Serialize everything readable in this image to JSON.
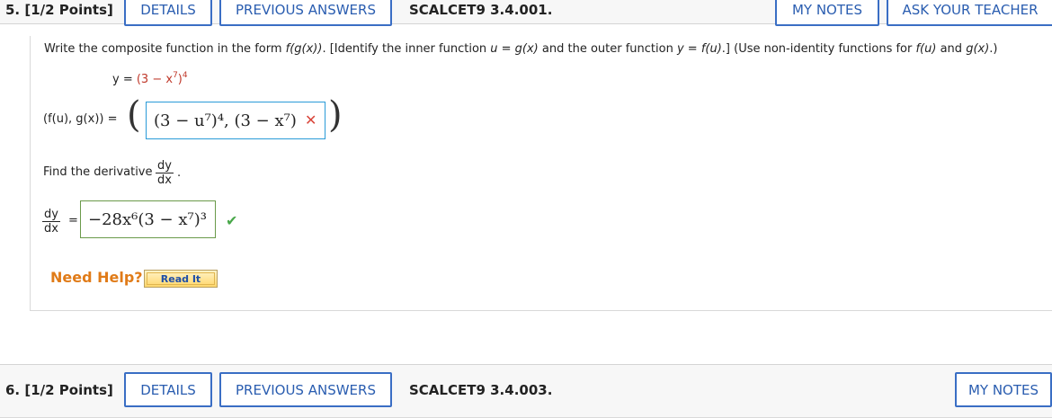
{
  "question5": {
    "number": "5.",
    "points": "[1/2 Points]",
    "details_label": "DETAILS",
    "previous_answers_label": "PREVIOUS ANSWERS",
    "code": "SCALCET9 3.4.001.",
    "my_notes_label": "MY NOTES",
    "ask_teacher_label": "ASK YOUR TEACHER",
    "prompt_start": "Write the composite function in the form ",
    "prompt_form": "f(g(x))",
    "prompt_mid": ". [Identify the inner function ",
    "prompt_inner": "u = g(x)",
    "prompt_mid2": " and the outer function ",
    "prompt_outer": "y = f(u)",
    "prompt_end": ".] (Use non-identity functions for ",
    "prompt_fu": "f(u)",
    "prompt_and": " and ",
    "prompt_gx": "g(x)",
    "prompt_close": ".)",
    "y_prefix": "y = ",
    "y_expr": "(3 − x",
    "y_exp7": "7",
    "y_close": ")",
    "y_exp4": "4",
    "pair_label": "(f(u), g(x)) =",
    "pair_answer": "(3 − u⁷)⁴, (3 − x⁷)",
    "pair_status": "✕",
    "derivative_prompt": "Find the derivative",
    "dy": "dy",
    "dx": "dx",
    "period": ".",
    "equals": "=",
    "derivative_answer": "−28x⁶(3 − x⁷)³",
    "derivative_status": "✔",
    "need_help": "Need Help?",
    "read_it_label": "Read It"
  },
  "question6": {
    "number": "6.",
    "points": "[1/2 Points]",
    "details_label": "DETAILS",
    "previous_answers_label": "PREVIOUS ANSWERS",
    "code": "SCALCET9 3.4.003.",
    "my_notes_label": "MY NOTES"
  },
  "colors": {
    "button_blue": "#2a5db0",
    "incorrect_red": "#d9463b",
    "correct_green": "#49a84a",
    "help_orange": "#e07b18"
  }
}
